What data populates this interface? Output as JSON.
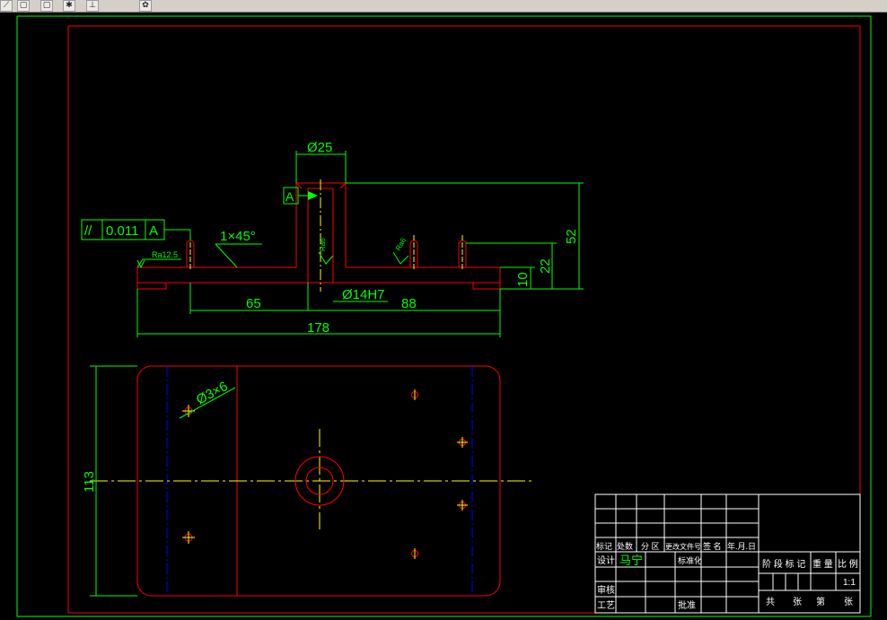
{
  "toolbar": {
    "icons": [
      "draw-icon",
      "copy-icon",
      "paste-icon",
      "snap-icon",
      "pointer-icon",
      "properties-icon"
    ],
    "glyphs": [
      "⟋",
      "▢",
      "▢",
      "✱",
      "⊥",
      "✿"
    ]
  },
  "drawing": {
    "colors": {
      "background": "#000000",
      "outer_border": "#00ff00",
      "inner_border": "#ff0000",
      "part": "#ff0000",
      "dimension": "#00ff00",
      "centerline": "#ffff00",
      "hidden": "#0000ff",
      "table_lines": "#ffffff",
      "table_text_green": "#00ff00"
    },
    "front_view": {
      "dim_top_dia": "Ø25",
      "datum": "A",
      "tolerance": [
        "//",
        "0.011",
        "A"
      ],
      "chamfer": "1×45°",
      "roughness_left": "Ra12.5",
      "roughness_mid": "Ra6",
      "roughness_right": "Ra6",
      "dim_65": "65",
      "dim_88": "88",
      "dim_178": "178",
      "dim_bore": "Ø14H7",
      "dim_52": "52",
      "dim_22": "22",
      "dim_10": "10"
    },
    "top_view": {
      "dim_holes": "Ø3×6",
      "dim_113": "113"
    },
    "title_block": {
      "header_cells": [
        "标记",
        "处数",
        "分 区",
        "更改文件号",
        "签 名",
        "年.月.日"
      ],
      "design_label": "设计",
      "designer_name": "马宁",
      "standardize_label": "标准化",
      "review_label": "审核",
      "process_label": "工艺",
      "approve_label": "批准",
      "stage_labels": [
        "阶 段 标 记",
        "重 量",
        "比 例"
      ],
      "scale_value": "1:1",
      "sheet_labels": [
        "共",
        "张",
        "第",
        "张"
      ]
    }
  }
}
